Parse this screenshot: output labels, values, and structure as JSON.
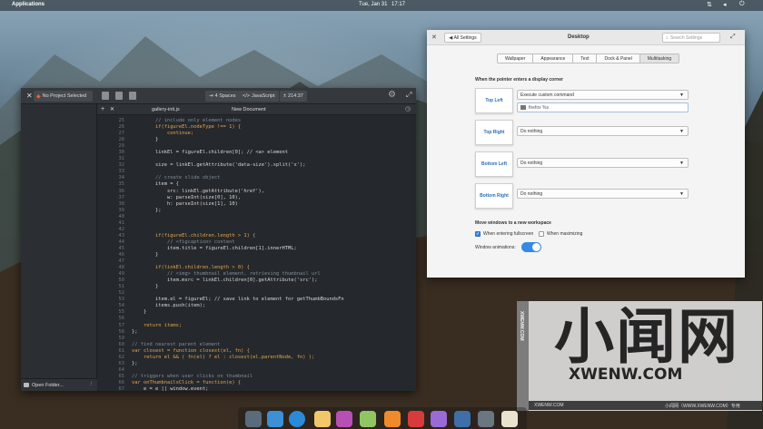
{
  "top_panel": {
    "applications": "Applications",
    "date": "Tue, Jan 31",
    "time": "17:17"
  },
  "editor": {
    "project_button": "No Project Selected",
    "indent": "4 Spaces",
    "language": "JavaScript",
    "position": "214:37",
    "tab_file": "gallery-init.js",
    "tab_new": "New Document",
    "open_folder": "Open Folder...",
    "line_numbers": [
      "25",
      "26",
      "27",
      "28",
      "29",
      "30",
      "31",
      "32",
      "33",
      "34",
      "35",
      "36",
      "37",
      "38",
      "39",
      "40",
      "41",
      "42",
      "43",
      "44",
      "45",
      "46",
      "47",
      "48",
      "49",
      "50",
      "51",
      "52",
      "53",
      "54",
      "55",
      "56",
      "57",
      "58",
      "59",
      "60",
      "61",
      "62",
      "63",
      "64",
      "65",
      "66",
      "67"
    ],
    "code_lines": [
      "        // include only element nodes",
      "        if(figureEl.nodeType !== 1) {",
      "            continue;",
      "        }",
      "",
      "        linkEl = figureEl.children[0]; // <a> element",
      "",
      "        size = linkEl.getAttribute('data-size').split('x');",
      "",
      "        // create slide object",
      "        item = {",
      "            src: linkEl.getAttribute('href'),",
      "            w: parseInt(size[0], 10),",
      "            h: parseInt(size[1], 10)",
      "        };",
      "",
      "",
      "",
      "        if(figureEl.children.length > 1) {",
      "            // <figcaption> content",
      "            item.title = figureEl.children[1].innerHTML;",
      "        }",
      "",
      "        if(linkEl.children.length > 0) {",
      "            // <img> thumbnail element, retrieving thumbnail url",
      "            item.msrc = linkEl.children[0].getAttribute('src');",
      "        }",
      "",
      "        item.el = figureEl; // save link to element for getThumbBoundsFn",
      "        items.push(item);",
      "    }",
      "",
      "    return items;",
      "};",
      "",
      "// find nearest parent element",
      "var closest = function closest(el, fn) {",
      "    return el && ( fn(el) ? el : closest(el.parentNode, fn) );",
      "};",
      "",
      "// triggers when user clicks on thumbnail",
      "var onThumbnailsClick = function(e) {",
      "    e = e || window.event;"
    ]
  },
  "settings": {
    "back_button": "All Settings",
    "title": "Desktop",
    "search_placeholder": "Search Settings",
    "tabs": [
      "Wallpaper",
      "Appearance",
      "Text",
      "Dock & Panel",
      "Multitasking"
    ],
    "hot_corners_title": "When the pointer enters a display corner",
    "corners": [
      {
        "label": "Top Left",
        "action": "Execute custom command"
      },
      {
        "label": "Top Right",
        "action": "Do nothing"
      },
      {
        "label": "Bottom Left",
        "action": "Do nothing"
      },
      {
        "label": "Bottom Right",
        "action": "Do nothing"
      }
    ],
    "custom_command": "firefox %s",
    "workspace_title": "Move windows to a new workspace",
    "when_fullscreen": "When entering fullscreen",
    "when_maximizing": "When maximizing",
    "window_animations": "Window animations:"
  },
  "watermark": {
    "big_text": "小闻网",
    "url": "XWENW.COM",
    "vertical": "XWENW.COM",
    "bottom_left": "XWENW.COM",
    "bottom_right": "小闻网（WWW.XWENW.COM）专用"
  },
  "colors": {
    "accent_blue": "#3689e6",
    "editor_bg": "#25292d",
    "comment": "#7f8b95",
    "keyword": "#e5a44a",
    "string": "#9fc36e"
  }
}
